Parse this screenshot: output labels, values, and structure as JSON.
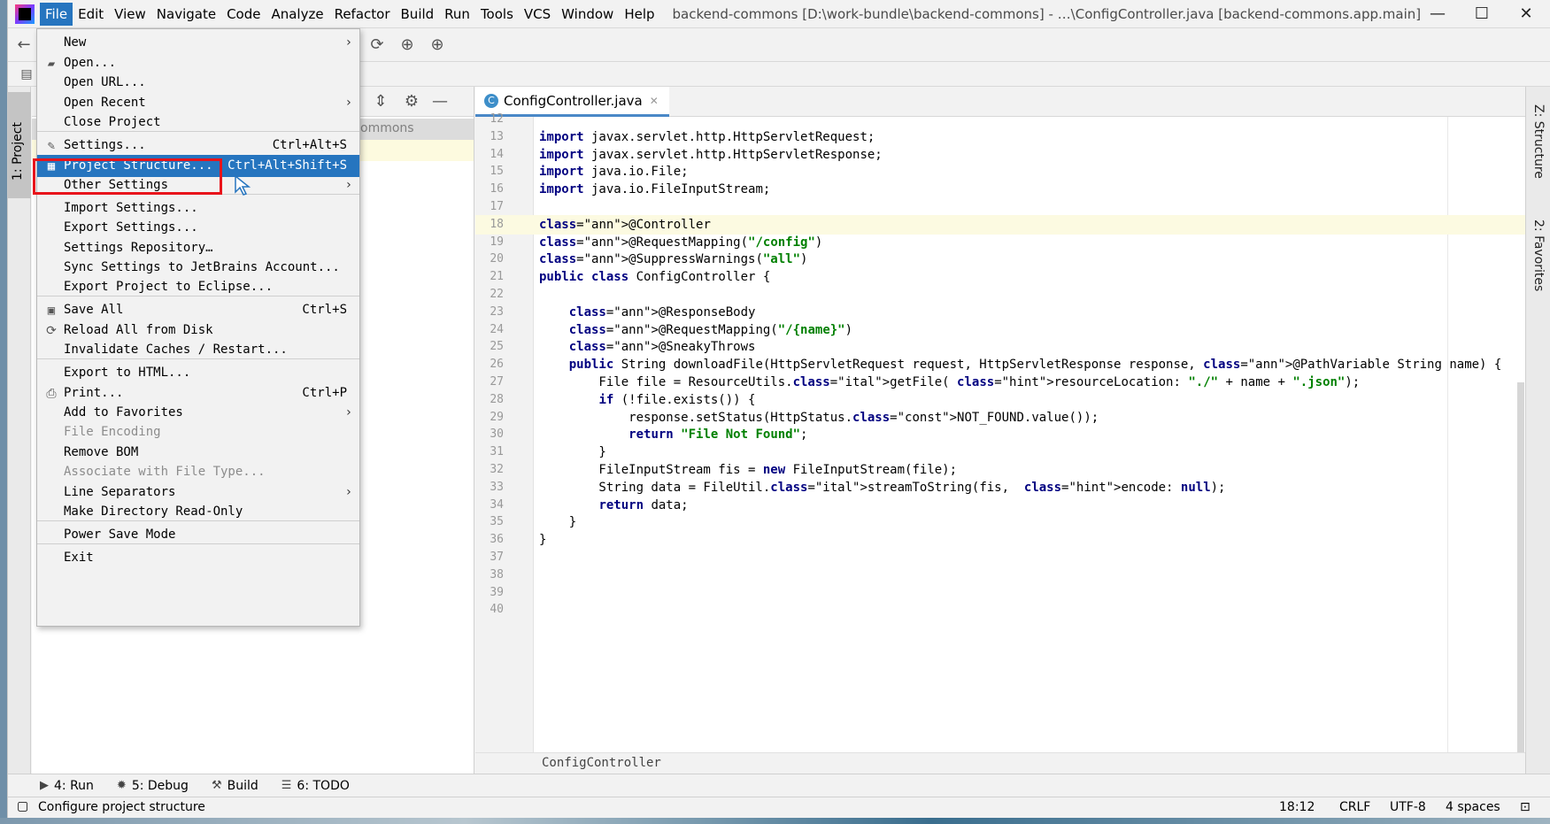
{
  "menubar": {
    "items": [
      "File",
      "Edit",
      "View",
      "Navigate",
      "Code",
      "Analyze",
      "Refactor",
      "Build",
      "Run",
      "Tools",
      "VCS",
      "Window",
      "Help"
    ],
    "title": "backend-commons [D:\\work-bundle\\backend-commons] - …\\ConfigController.java [backend-commons.app.main]"
  },
  "window_controls": {
    "minimize": "—",
    "maximize": "☐",
    "close": "✕"
  },
  "left_strip": {
    "project_tab": "1: Project"
  },
  "project_panel": {
    "tree_fragment": "ommons"
  },
  "editor": {
    "tab_label": "ConfigController.java",
    "tab_icon": "C",
    "breadcrumb": "ConfigController",
    "lines": [
      {
        "n": "12",
        "code": ""
      },
      {
        "n": "13",
        "code": "import javax.servlet.http.HttpServletRequest;"
      },
      {
        "n": "14",
        "code": "import javax.servlet.http.HttpServletResponse;"
      },
      {
        "n": "15",
        "code": "import java.io.File;"
      },
      {
        "n": "16",
        "code": "import java.io.FileInputStream;"
      },
      {
        "n": "17",
        "code": ""
      },
      {
        "n": "18",
        "code": "@Controller"
      },
      {
        "n": "19",
        "code": "@RequestMapping(\"/config\")"
      },
      {
        "n": "20",
        "code": "@SuppressWarnings(\"all\")"
      },
      {
        "n": "21",
        "code": "public class ConfigController {"
      },
      {
        "n": "22",
        "code": ""
      },
      {
        "n": "23",
        "code": "    @ResponseBody"
      },
      {
        "n": "24",
        "code": "    @RequestMapping(\"/{name}\")"
      },
      {
        "n": "25",
        "code": "    @SneakyThrows"
      },
      {
        "n": "26",
        "code": "    public String downloadFile(HttpServletRequest request, HttpServletResponse response, @PathVariable String name) {"
      },
      {
        "n": "27",
        "code": "        File file = ResourceUtils.getFile( resourceLocation: \"./\" + name + \".json\");"
      },
      {
        "n": "28",
        "code": "        if (!file.exists()) {"
      },
      {
        "n": "29",
        "code": "            response.setStatus(HttpStatus.NOT_FOUND.value());"
      },
      {
        "n": "30",
        "code": "            return \"File Not Found\";"
      },
      {
        "n": "31",
        "code": "        }"
      },
      {
        "n": "32",
        "code": "        FileInputStream fis = new FileInputStream(file);"
      },
      {
        "n": "33",
        "code": "        String data = FileUtil.streamToString(fis,  encode: null);"
      },
      {
        "n": "34",
        "code": "        return data;"
      },
      {
        "n": "35",
        "code": "    }"
      },
      {
        "n": "36",
        "code": "}"
      },
      {
        "n": "37",
        "code": ""
      },
      {
        "n": "38",
        "code": ""
      },
      {
        "n": "39",
        "code": ""
      },
      {
        "n": "40",
        "code": ""
      }
    ],
    "current_line": "18"
  },
  "right_strip": {
    "structure_tab": "Z: Structure",
    "favorites_tab": "2: Favorites"
  },
  "bottom_tools": {
    "run": "4: Run",
    "debug": "5: Debug",
    "build": "Build",
    "todo": "6: TODO"
  },
  "statusbar": {
    "message": "Configure project structure",
    "position": "18:12",
    "line_sep": "CRLF",
    "encoding": "UTF-8",
    "indent": "4 spaces"
  },
  "file_menu": {
    "items": [
      {
        "label": "New",
        "shortcut": "",
        "submenu": true,
        "icon": "",
        "disabled": false
      },
      {
        "label": "Open...",
        "shortcut": "",
        "submenu": false,
        "icon": "folder-icon",
        "disabled": false
      },
      {
        "label": "Open URL...",
        "shortcut": "",
        "submenu": false,
        "icon": "",
        "disabled": false
      },
      {
        "label": "Open Recent",
        "shortcut": "",
        "submenu": true,
        "icon": "",
        "disabled": false
      },
      {
        "label": "Close Project",
        "shortcut": "",
        "submenu": false,
        "icon": "",
        "disabled": false
      },
      {
        "label": "Settings...",
        "shortcut": "Ctrl+Alt+S",
        "submenu": false,
        "icon": "wrench-icon",
        "disabled": false
      },
      {
        "label": "Project Structure...",
        "shortcut": "Ctrl+Alt+Shift+S",
        "submenu": false,
        "icon": "project-structure-icon",
        "disabled": false,
        "selected": true
      },
      {
        "label": "Other Settings",
        "shortcut": "",
        "submenu": true,
        "icon": "",
        "disabled": false
      },
      {
        "label": "Import Settings...",
        "shortcut": "",
        "submenu": false,
        "icon": "",
        "disabled": false
      },
      {
        "label": "Export Settings...",
        "shortcut": "",
        "submenu": false,
        "icon": "",
        "disabled": false
      },
      {
        "label": "Settings Repository…",
        "shortcut": "",
        "submenu": false,
        "icon": "",
        "disabled": false
      },
      {
        "label": "Sync Settings to JetBrains Account...",
        "shortcut": "",
        "submenu": false,
        "icon": "",
        "disabled": false
      },
      {
        "label": "Export Project to Eclipse...",
        "shortcut": "",
        "submenu": false,
        "icon": "",
        "disabled": false
      },
      {
        "label": "Save All",
        "shortcut": "Ctrl+S",
        "submenu": false,
        "icon": "save-icon",
        "disabled": false
      },
      {
        "label": "Reload All from Disk",
        "shortcut": "",
        "submenu": false,
        "icon": "reload-icon",
        "disabled": false
      },
      {
        "label": "Invalidate Caches / Restart...",
        "shortcut": "",
        "submenu": false,
        "icon": "",
        "disabled": false
      },
      {
        "label": "Export to HTML...",
        "shortcut": "",
        "submenu": false,
        "icon": "",
        "disabled": false
      },
      {
        "label": "Print...",
        "shortcut": "Ctrl+P",
        "submenu": false,
        "icon": "print-icon",
        "disabled": false
      },
      {
        "label": "Add to Favorites",
        "shortcut": "",
        "submenu": true,
        "icon": "",
        "disabled": false
      },
      {
        "label": "File Encoding",
        "shortcut": "",
        "submenu": false,
        "icon": "",
        "disabled": true
      },
      {
        "label": "Remove BOM",
        "shortcut": "",
        "submenu": false,
        "icon": "",
        "disabled": false
      },
      {
        "label": "Associate with File Type...",
        "shortcut": "",
        "submenu": false,
        "icon": "",
        "disabled": true
      },
      {
        "label": "Line Separators",
        "shortcut": "",
        "submenu": true,
        "icon": "",
        "disabled": false
      },
      {
        "label": "Make Directory Read-Only",
        "shortcut": "",
        "submenu": false,
        "icon": "",
        "disabled": false
      },
      {
        "label": "Power Save Mode",
        "shortcut": "",
        "submenu": false,
        "icon": "",
        "disabled": false
      },
      {
        "label": "Exit",
        "shortcut": "",
        "submenu": false,
        "icon": "",
        "disabled": false
      }
    ]
  },
  "colors": {
    "menu_selection": "#2675bf",
    "highlight_box": "#e8141b",
    "keyword": "#000080",
    "annotation": "#808000",
    "string": "#008000"
  }
}
